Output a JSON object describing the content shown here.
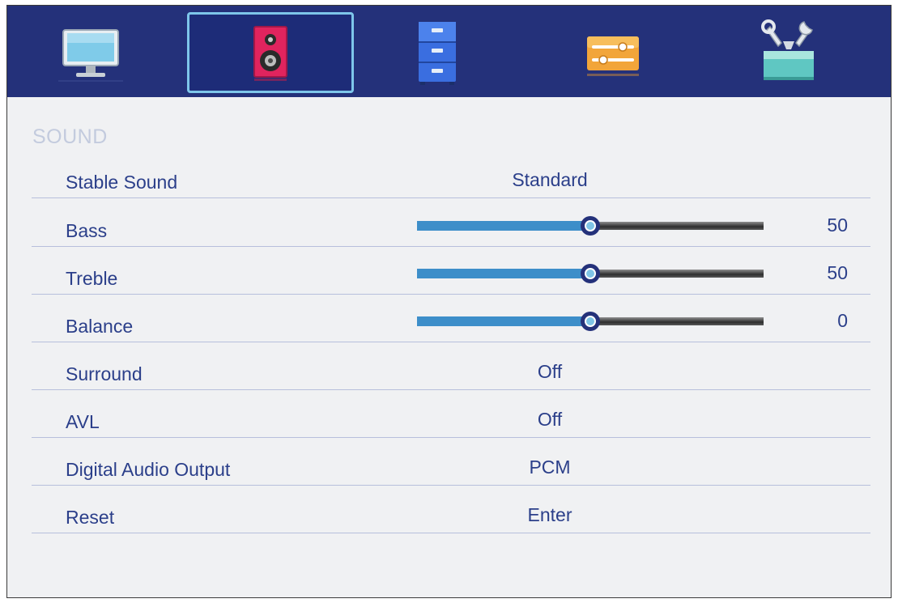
{
  "section_title": "SOUND",
  "tabs": [
    {
      "name": "picture",
      "icon": "monitor-icon",
      "active": false
    },
    {
      "name": "sound",
      "icon": "speaker-icon",
      "active": true
    },
    {
      "name": "channel",
      "icon": "cabinet-icon",
      "active": false
    },
    {
      "name": "function",
      "icon": "sliders-icon",
      "active": false
    },
    {
      "name": "setup",
      "icon": "tools-icon",
      "active": false
    }
  ],
  "items": [
    {
      "label": "Stable Sound",
      "value": "Standard"
    },
    {
      "label": "Bass",
      "level": 50,
      "level_fraction": 0.5,
      "value": "50"
    },
    {
      "label": "Treble",
      "level": 50,
      "level_fraction": 0.5,
      "value": "50"
    },
    {
      "label": "Balance",
      "level": 0,
      "level_fraction": 0.5,
      "value": "0"
    },
    {
      "label": "Surround",
      "value": "Off"
    },
    {
      "label": "AVL",
      "value": "Off"
    },
    {
      "label": "Digital Audio Output",
      "value": "PCM"
    },
    {
      "label": "Reset",
      "value": "Enter"
    }
  ],
  "colors": {
    "header_bg": "#24317a",
    "active_tab_border": "#7ec6ea",
    "text": "#2b3f8a",
    "slider_fill": "#3d8ec9",
    "title_text": "#c3cbde"
  }
}
